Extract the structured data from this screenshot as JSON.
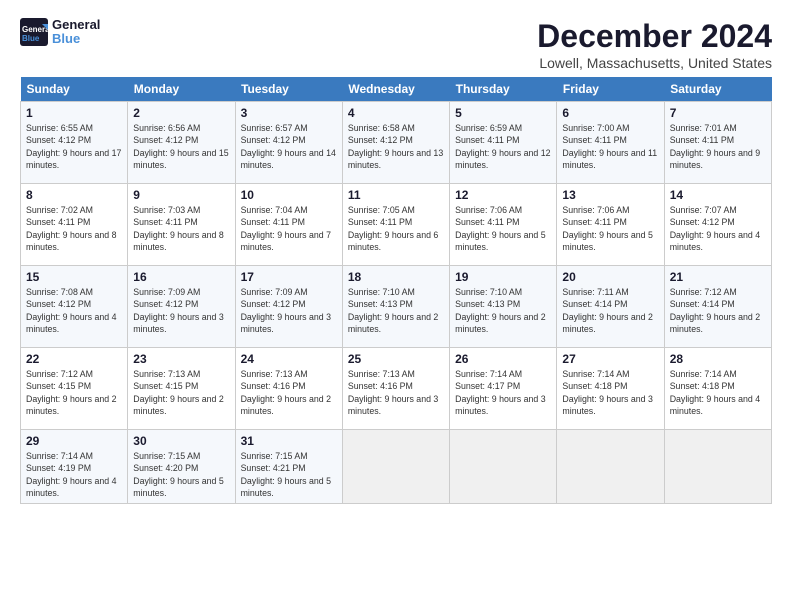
{
  "header": {
    "logo_general": "General",
    "logo_blue": "Blue",
    "title": "December 2024",
    "location": "Lowell, Massachusetts, United States"
  },
  "weekdays": [
    "Sunday",
    "Monday",
    "Tuesday",
    "Wednesday",
    "Thursday",
    "Friday",
    "Saturday"
  ],
  "weeks": [
    [
      {
        "day": "1",
        "sunrise": "6:55 AM",
        "sunset": "4:12 PM",
        "daylight": "9 hours and 17 minutes."
      },
      {
        "day": "2",
        "sunrise": "6:56 AM",
        "sunset": "4:12 PM",
        "daylight": "9 hours and 15 minutes."
      },
      {
        "day": "3",
        "sunrise": "6:57 AM",
        "sunset": "4:12 PM",
        "daylight": "9 hours and 14 minutes."
      },
      {
        "day": "4",
        "sunrise": "6:58 AM",
        "sunset": "4:12 PM",
        "daylight": "9 hours and 13 minutes."
      },
      {
        "day": "5",
        "sunrise": "6:59 AM",
        "sunset": "4:11 PM",
        "daylight": "9 hours and 12 minutes."
      },
      {
        "day": "6",
        "sunrise": "7:00 AM",
        "sunset": "4:11 PM",
        "daylight": "9 hours and 11 minutes."
      },
      {
        "day": "7",
        "sunrise": "7:01 AM",
        "sunset": "4:11 PM",
        "daylight": "9 hours and 9 minutes."
      }
    ],
    [
      {
        "day": "8",
        "sunrise": "7:02 AM",
        "sunset": "4:11 PM",
        "daylight": "9 hours and 8 minutes."
      },
      {
        "day": "9",
        "sunrise": "7:03 AM",
        "sunset": "4:11 PM",
        "daylight": "9 hours and 8 minutes."
      },
      {
        "day": "10",
        "sunrise": "7:04 AM",
        "sunset": "4:11 PM",
        "daylight": "9 hours and 7 minutes."
      },
      {
        "day": "11",
        "sunrise": "7:05 AM",
        "sunset": "4:11 PM",
        "daylight": "9 hours and 6 minutes."
      },
      {
        "day": "12",
        "sunrise": "7:06 AM",
        "sunset": "4:11 PM",
        "daylight": "9 hours and 5 minutes."
      },
      {
        "day": "13",
        "sunrise": "7:06 AM",
        "sunset": "4:11 PM",
        "daylight": "9 hours and 5 minutes."
      },
      {
        "day": "14",
        "sunrise": "7:07 AM",
        "sunset": "4:12 PM",
        "daylight": "9 hours and 4 minutes."
      }
    ],
    [
      {
        "day": "15",
        "sunrise": "7:08 AM",
        "sunset": "4:12 PM",
        "daylight": "9 hours and 4 minutes."
      },
      {
        "day": "16",
        "sunrise": "7:09 AM",
        "sunset": "4:12 PM",
        "daylight": "9 hours and 3 minutes."
      },
      {
        "day": "17",
        "sunrise": "7:09 AM",
        "sunset": "4:12 PM",
        "daylight": "9 hours and 3 minutes."
      },
      {
        "day": "18",
        "sunrise": "7:10 AM",
        "sunset": "4:13 PM",
        "daylight": "9 hours and 2 minutes."
      },
      {
        "day": "19",
        "sunrise": "7:10 AM",
        "sunset": "4:13 PM",
        "daylight": "9 hours and 2 minutes."
      },
      {
        "day": "20",
        "sunrise": "7:11 AM",
        "sunset": "4:14 PM",
        "daylight": "9 hours and 2 minutes."
      },
      {
        "day": "21",
        "sunrise": "7:12 AM",
        "sunset": "4:14 PM",
        "daylight": "9 hours and 2 minutes."
      }
    ],
    [
      {
        "day": "22",
        "sunrise": "7:12 AM",
        "sunset": "4:15 PM",
        "daylight": "9 hours and 2 minutes."
      },
      {
        "day": "23",
        "sunrise": "7:13 AM",
        "sunset": "4:15 PM",
        "daylight": "9 hours and 2 minutes."
      },
      {
        "day": "24",
        "sunrise": "7:13 AM",
        "sunset": "4:16 PM",
        "daylight": "9 hours and 2 minutes."
      },
      {
        "day": "25",
        "sunrise": "7:13 AM",
        "sunset": "4:16 PM",
        "daylight": "9 hours and 3 minutes."
      },
      {
        "day": "26",
        "sunrise": "7:14 AM",
        "sunset": "4:17 PM",
        "daylight": "9 hours and 3 minutes."
      },
      {
        "day": "27",
        "sunrise": "7:14 AM",
        "sunset": "4:18 PM",
        "daylight": "9 hours and 3 minutes."
      },
      {
        "day": "28",
        "sunrise": "7:14 AM",
        "sunset": "4:18 PM",
        "daylight": "9 hours and 4 minutes."
      }
    ],
    [
      {
        "day": "29",
        "sunrise": "7:14 AM",
        "sunset": "4:19 PM",
        "daylight": "9 hours and 4 minutes."
      },
      {
        "day": "30",
        "sunrise": "7:15 AM",
        "sunset": "4:20 PM",
        "daylight": "9 hours and 5 minutes."
      },
      {
        "day": "31",
        "sunrise": "7:15 AM",
        "sunset": "4:21 PM",
        "daylight": "9 hours and 5 minutes."
      },
      null,
      null,
      null,
      null
    ]
  ]
}
